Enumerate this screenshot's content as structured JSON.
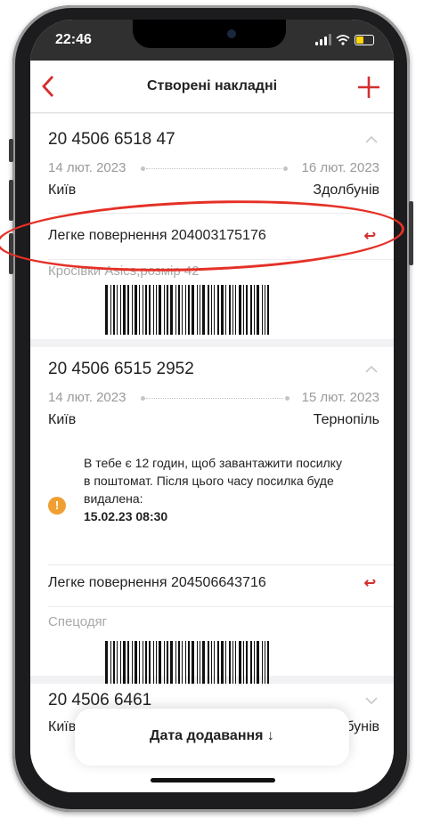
{
  "status_bar": {
    "time": "22:46"
  },
  "header": {
    "back_label": "<",
    "title": "Створені накладні",
    "add_label": "+"
  },
  "shipments": [
    {
      "number": "20 4506 6518 47",
      "date_from": "14 лют. 2023",
      "date_to": "16 лют. 2023",
      "city_from": "Київ",
      "city_to": "Здолбунів",
      "return_label": "Легке повернення 204003175176",
      "item_description": "Кросівки Asics,розмір 42"
    },
    {
      "number": "20 4506 6515 2952",
      "date_from": "14 лют. 2023",
      "date_to": "15 лют. 2023",
      "city_from": "Київ",
      "city_to": "Тернопіль",
      "warning_text": "В тебе є 12 годин, щоб завантажити посилку в поштомат. Після цього часу посилка буде видалена:",
      "warning_deadline": "15.02.23 08:30",
      "return_label": "Легке повернення 204506643716",
      "item_description": "Спецодяг"
    },
    {
      "number": "20 4506 6461",
      "city_from": "Київ",
      "city_to": "Здолбунів"
    }
  ],
  "sort_button": {
    "label": "Дата додавання ↓"
  },
  "colors": {
    "accent": "#d32f2f",
    "warning": "#f0a033",
    "annotation": "#e53026"
  },
  "icons": [
    "back-chevron-icon",
    "plus-icon",
    "chevron-up-icon",
    "chevron-down-icon",
    "return-arrow-icon",
    "warning-icon",
    "signal-icon",
    "wifi-icon",
    "battery-icon"
  ]
}
